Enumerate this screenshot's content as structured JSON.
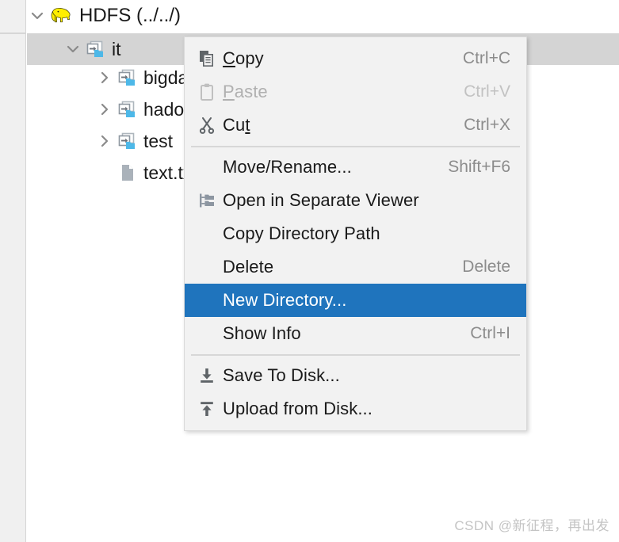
{
  "colors": {
    "menu_background": "#f2f2f2",
    "menu_border": "#d9d9d9",
    "highlight": "#1f74bd",
    "selected_row": "#d4d4d4",
    "panel_background": "#ffffff",
    "gutter": "#f0f0f0",
    "folder_accent": "#4db8e8",
    "icon_gray": "#7a8694",
    "shortcut_text": "#8c8c8c",
    "disabled_text": "#b0b0b0",
    "watermark_text": "#c4c4c4",
    "elephant_yellow": "#ffee00"
  },
  "tree": {
    "root": {
      "label": "HDFS (../../)",
      "icon": "hadoop-elephant-icon",
      "expanded": true,
      "twisty": "chevron-down-icon"
    },
    "items": [
      {
        "label": "it",
        "icon": "remote-folder-icon",
        "twisty": "chevron-down-icon",
        "expanded": true,
        "selected": true,
        "depth": 1
      },
      {
        "label": "bigdata",
        "icon": "remote-folder-icon",
        "twisty": "chevron-right-icon",
        "expanded": false,
        "selected": false,
        "depth": 2
      },
      {
        "label": "hadoop",
        "icon": "remote-folder-icon",
        "twisty": "chevron-right-icon",
        "expanded": false,
        "selected": false,
        "depth": 2
      },
      {
        "label": "test",
        "icon": "remote-folder-icon",
        "twisty": "chevron-right-icon",
        "expanded": false,
        "selected": false,
        "depth": 2
      },
      {
        "label": "text.txt",
        "icon": "file-icon",
        "twisty": "",
        "expanded": false,
        "selected": false,
        "depth": 2
      }
    ]
  },
  "context_menu": {
    "items": [
      {
        "id": "copy",
        "label": "Copy",
        "mnemonic": "C",
        "shortcut": "Ctrl+C",
        "icon": "copy-icon",
        "disabled": false,
        "highlighted": false
      },
      {
        "id": "paste",
        "label": "Paste",
        "mnemonic": "P",
        "shortcut": "Ctrl+V",
        "icon": "paste-icon",
        "disabled": true,
        "highlighted": false
      },
      {
        "id": "cut",
        "label": "Cut",
        "mnemonic": "t",
        "shortcut": "Ctrl+X",
        "icon": "cut-icon",
        "disabled": false,
        "highlighted": false
      },
      {
        "id": "separator-1",
        "type": "separator"
      },
      {
        "id": "move-rename",
        "label": "Move/Rename...",
        "mnemonic": "",
        "shortcut": "Shift+F6",
        "icon": "",
        "disabled": false,
        "highlighted": false
      },
      {
        "id": "open-in-separate-viewer",
        "label": "Open in Separate Viewer",
        "mnemonic": "",
        "shortcut": "",
        "icon": "separate-viewer-icon",
        "disabled": false,
        "highlighted": false
      },
      {
        "id": "copy-directory-path",
        "label": "Copy Directory Path",
        "mnemonic": "",
        "shortcut": "",
        "icon": "",
        "disabled": false,
        "highlighted": false
      },
      {
        "id": "delete",
        "label": "Delete",
        "mnemonic": "",
        "shortcut": "Delete",
        "icon": "",
        "disabled": false,
        "highlighted": false
      },
      {
        "id": "new-directory",
        "label": "New Directory...",
        "mnemonic": "",
        "shortcut": "",
        "icon": "",
        "disabled": false,
        "highlighted": true
      },
      {
        "id": "show-info",
        "label": "Show Info",
        "mnemonic": "",
        "shortcut": "Ctrl+I",
        "icon": "",
        "disabled": false,
        "highlighted": false
      },
      {
        "id": "separator-2",
        "type": "separator"
      },
      {
        "id": "save-to-disk",
        "label": "Save To Disk...",
        "mnemonic": "",
        "shortcut": "",
        "icon": "download-icon",
        "disabled": false,
        "highlighted": false
      },
      {
        "id": "upload-from-disk",
        "label": "Upload from Disk...",
        "mnemonic": "",
        "shortcut": "",
        "icon": "upload-icon",
        "disabled": false,
        "highlighted": false
      }
    ]
  },
  "watermark": {
    "text": "CSDN @新征程，再出发"
  }
}
